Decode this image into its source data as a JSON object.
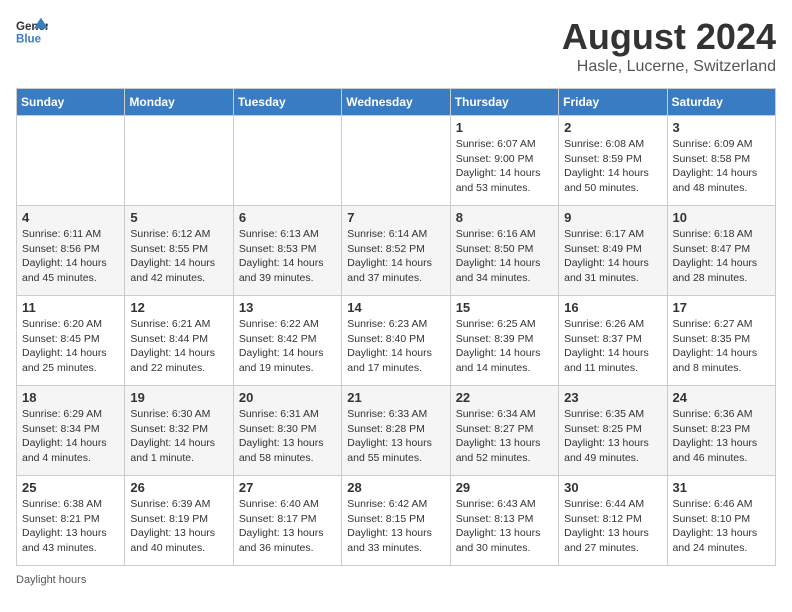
{
  "header": {
    "logo_general": "General",
    "logo_blue": "Blue",
    "month_year": "August 2024",
    "location": "Hasle, Lucerne, Switzerland"
  },
  "days_of_week": [
    "Sunday",
    "Monday",
    "Tuesday",
    "Wednesday",
    "Thursday",
    "Friday",
    "Saturday"
  ],
  "weeks": [
    [
      {
        "day": "",
        "info": ""
      },
      {
        "day": "",
        "info": ""
      },
      {
        "day": "",
        "info": ""
      },
      {
        "day": "",
        "info": ""
      },
      {
        "day": "1",
        "info": "Sunrise: 6:07 AM\nSunset: 9:00 PM\nDaylight: 14 hours\nand 53 minutes."
      },
      {
        "day": "2",
        "info": "Sunrise: 6:08 AM\nSunset: 8:59 PM\nDaylight: 14 hours\nand 50 minutes."
      },
      {
        "day": "3",
        "info": "Sunrise: 6:09 AM\nSunset: 8:58 PM\nDaylight: 14 hours\nand 48 minutes."
      }
    ],
    [
      {
        "day": "4",
        "info": "Sunrise: 6:11 AM\nSunset: 8:56 PM\nDaylight: 14 hours\nand 45 minutes."
      },
      {
        "day": "5",
        "info": "Sunrise: 6:12 AM\nSunset: 8:55 PM\nDaylight: 14 hours\nand 42 minutes."
      },
      {
        "day": "6",
        "info": "Sunrise: 6:13 AM\nSunset: 8:53 PM\nDaylight: 14 hours\nand 39 minutes."
      },
      {
        "day": "7",
        "info": "Sunrise: 6:14 AM\nSunset: 8:52 PM\nDaylight: 14 hours\nand 37 minutes."
      },
      {
        "day": "8",
        "info": "Sunrise: 6:16 AM\nSunset: 8:50 PM\nDaylight: 14 hours\nand 34 minutes."
      },
      {
        "day": "9",
        "info": "Sunrise: 6:17 AM\nSunset: 8:49 PM\nDaylight: 14 hours\nand 31 minutes."
      },
      {
        "day": "10",
        "info": "Sunrise: 6:18 AM\nSunset: 8:47 PM\nDaylight: 14 hours\nand 28 minutes."
      }
    ],
    [
      {
        "day": "11",
        "info": "Sunrise: 6:20 AM\nSunset: 8:45 PM\nDaylight: 14 hours\nand 25 minutes."
      },
      {
        "day": "12",
        "info": "Sunrise: 6:21 AM\nSunset: 8:44 PM\nDaylight: 14 hours\nand 22 minutes."
      },
      {
        "day": "13",
        "info": "Sunrise: 6:22 AM\nSunset: 8:42 PM\nDaylight: 14 hours\nand 19 minutes."
      },
      {
        "day": "14",
        "info": "Sunrise: 6:23 AM\nSunset: 8:40 PM\nDaylight: 14 hours\nand 17 minutes."
      },
      {
        "day": "15",
        "info": "Sunrise: 6:25 AM\nSunset: 8:39 PM\nDaylight: 14 hours\nand 14 minutes."
      },
      {
        "day": "16",
        "info": "Sunrise: 6:26 AM\nSunset: 8:37 PM\nDaylight: 14 hours\nand 11 minutes."
      },
      {
        "day": "17",
        "info": "Sunrise: 6:27 AM\nSunset: 8:35 PM\nDaylight: 14 hours\nand 8 minutes."
      }
    ],
    [
      {
        "day": "18",
        "info": "Sunrise: 6:29 AM\nSunset: 8:34 PM\nDaylight: 14 hours\nand 4 minutes."
      },
      {
        "day": "19",
        "info": "Sunrise: 6:30 AM\nSunset: 8:32 PM\nDaylight: 14 hours\nand 1 minute."
      },
      {
        "day": "20",
        "info": "Sunrise: 6:31 AM\nSunset: 8:30 PM\nDaylight: 13 hours\nand 58 minutes."
      },
      {
        "day": "21",
        "info": "Sunrise: 6:33 AM\nSunset: 8:28 PM\nDaylight: 13 hours\nand 55 minutes."
      },
      {
        "day": "22",
        "info": "Sunrise: 6:34 AM\nSunset: 8:27 PM\nDaylight: 13 hours\nand 52 minutes."
      },
      {
        "day": "23",
        "info": "Sunrise: 6:35 AM\nSunset: 8:25 PM\nDaylight: 13 hours\nand 49 minutes."
      },
      {
        "day": "24",
        "info": "Sunrise: 6:36 AM\nSunset: 8:23 PM\nDaylight: 13 hours\nand 46 minutes."
      }
    ],
    [
      {
        "day": "25",
        "info": "Sunrise: 6:38 AM\nSunset: 8:21 PM\nDaylight: 13 hours\nand 43 minutes."
      },
      {
        "day": "26",
        "info": "Sunrise: 6:39 AM\nSunset: 8:19 PM\nDaylight: 13 hours\nand 40 minutes."
      },
      {
        "day": "27",
        "info": "Sunrise: 6:40 AM\nSunset: 8:17 PM\nDaylight: 13 hours\nand 36 minutes."
      },
      {
        "day": "28",
        "info": "Sunrise: 6:42 AM\nSunset: 8:15 PM\nDaylight: 13 hours\nand 33 minutes."
      },
      {
        "day": "29",
        "info": "Sunrise: 6:43 AM\nSunset: 8:13 PM\nDaylight: 13 hours\nand 30 minutes."
      },
      {
        "day": "30",
        "info": "Sunrise: 6:44 AM\nSunset: 8:12 PM\nDaylight: 13 hours\nand 27 minutes."
      },
      {
        "day": "31",
        "info": "Sunrise: 6:46 AM\nSunset: 8:10 PM\nDaylight: 13 hours\nand 24 minutes."
      }
    ]
  ],
  "footer": {
    "note": "Daylight hours"
  }
}
